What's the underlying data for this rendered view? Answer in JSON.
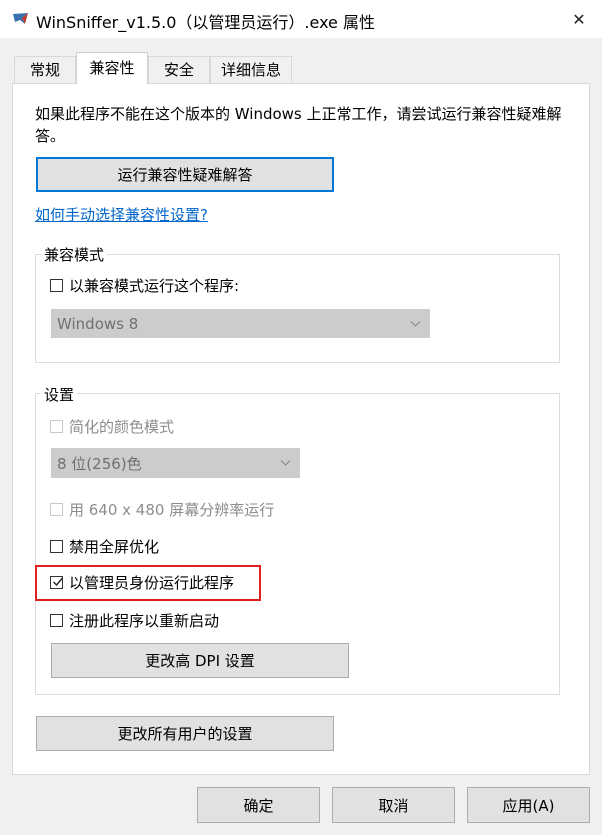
{
  "window": {
    "title": "WinSniffer_v1.5.0（以管理员运行）.exe 属性",
    "close_glyph": "✕"
  },
  "tabs": [
    {
      "label": "常规",
      "active": false
    },
    {
      "label": "兼容性",
      "active": true
    },
    {
      "label": "安全",
      "active": false
    },
    {
      "label": "详细信息",
      "active": false
    }
  ],
  "compat": {
    "description": "如果此程序不能在这个版本的 Windows 上正常工作，请尝试运行兼容性疑难解答。",
    "troubleshoot_button": "运行兼容性疑难解答",
    "manual_link": "如何手动选择兼容性设置?"
  },
  "compat_mode": {
    "group_label": "兼容模式",
    "checkbox_label": "以兼容模式运行这个程序:",
    "checked": false,
    "os_select_value": "Windows 8"
  },
  "settings": {
    "group_label": "设置",
    "reduced_color_label": "简化的颜色模式",
    "color_select_value": "8 位(256)色",
    "resolution_label": "用 640 x 480 屏幕分辨率运行",
    "disable_fullscreen_label": "禁用全屏优化",
    "run_as_admin_label": "以管理员身份运行此程序",
    "run_as_admin_checked": true,
    "register_restart_label": "注册此程序以重新启动",
    "dpi_button": "更改高 DPI 设置"
  },
  "all_users_button": "更改所有用户的设置",
  "footer": {
    "ok": "确定",
    "cancel": "取消",
    "apply": "应用(A)"
  },
  "colors": {
    "accent": "#0078d7",
    "link": "#0066cc",
    "highlight_box": "#e02020"
  }
}
